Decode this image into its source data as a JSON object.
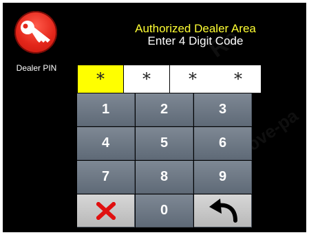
{
  "pin_button": {
    "icon": "key-icon",
    "label": "Dealer PIN",
    "color": "#e3261a"
  },
  "header": {
    "line1": "Authorized Dealer Area",
    "line2": "Enter 4 Digit Code",
    "line1_color": "#ffff33"
  },
  "code_slots": [
    "*",
    "*",
    "*",
    "*"
  ],
  "keypad": {
    "row1": [
      "1",
      "2",
      "3"
    ],
    "row2": [
      "4",
      "5",
      "6"
    ],
    "row3": [
      "7",
      "8",
      "9"
    ],
    "row4": {
      "clear_icon": "x-icon",
      "zero": "0",
      "back_icon": "undo-arrow-icon"
    }
  }
}
